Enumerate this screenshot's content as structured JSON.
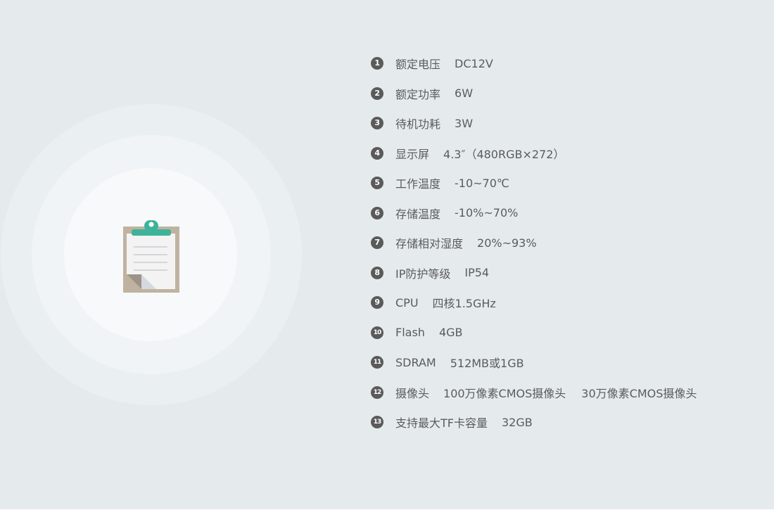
{
  "specs": [
    {
      "num": "1",
      "label": "额定电压",
      "values": [
        "DC12V"
      ]
    },
    {
      "num": "2",
      "label": "额定功率",
      "values": [
        "6W"
      ]
    },
    {
      "num": "3",
      "label": "待机功耗",
      "values": [
        "3W"
      ]
    },
    {
      "num": "4",
      "label": "显示屏",
      "values": [
        "4.3″（480RGB×272）"
      ]
    },
    {
      "num": "5",
      "label": "工作温度",
      "values": [
        "-10~70℃"
      ]
    },
    {
      "num": "6",
      "label": "存储温度",
      "values": [
        "-10%~70%"
      ]
    },
    {
      "num": "7",
      "label": "存储相对湿度",
      "values": [
        "20%~93%"
      ]
    },
    {
      "num": "8",
      "label": "IP防护等级",
      "values": [
        "IP54"
      ]
    },
    {
      "num": "9",
      "label": "CPU",
      "values": [
        "四核1.5GHz"
      ]
    },
    {
      "num": "10",
      "label": "Flash",
      "values": [
        "4GB"
      ]
    },
    {
      "num": "11",
      "label": "SDRAM",
      "values": [
        "512MB或1GB"
      ]
    },
    {
      "num": "12",
      "label": "摄像头",
      "values": [
        "100万像素CMOS摄像头",
        "30万像素CMOS摄像头"
      ]
    },
    {
      "num": "13",
      "label": "支持最大TF卡容量",
      "values": [
        "32GB"
      ]
    }
  ],
  "icons": {
    "illustration": "clipboard-icon"
  },
  "colors": {
    "background": "#e5ebed",
    "text": "#5b5b5b",
    "number_badge": "#5a5a5a",
    "clipboard_board": "#bfb3a0",
    "clipboard_clip": "#3db39a"
  }
}
